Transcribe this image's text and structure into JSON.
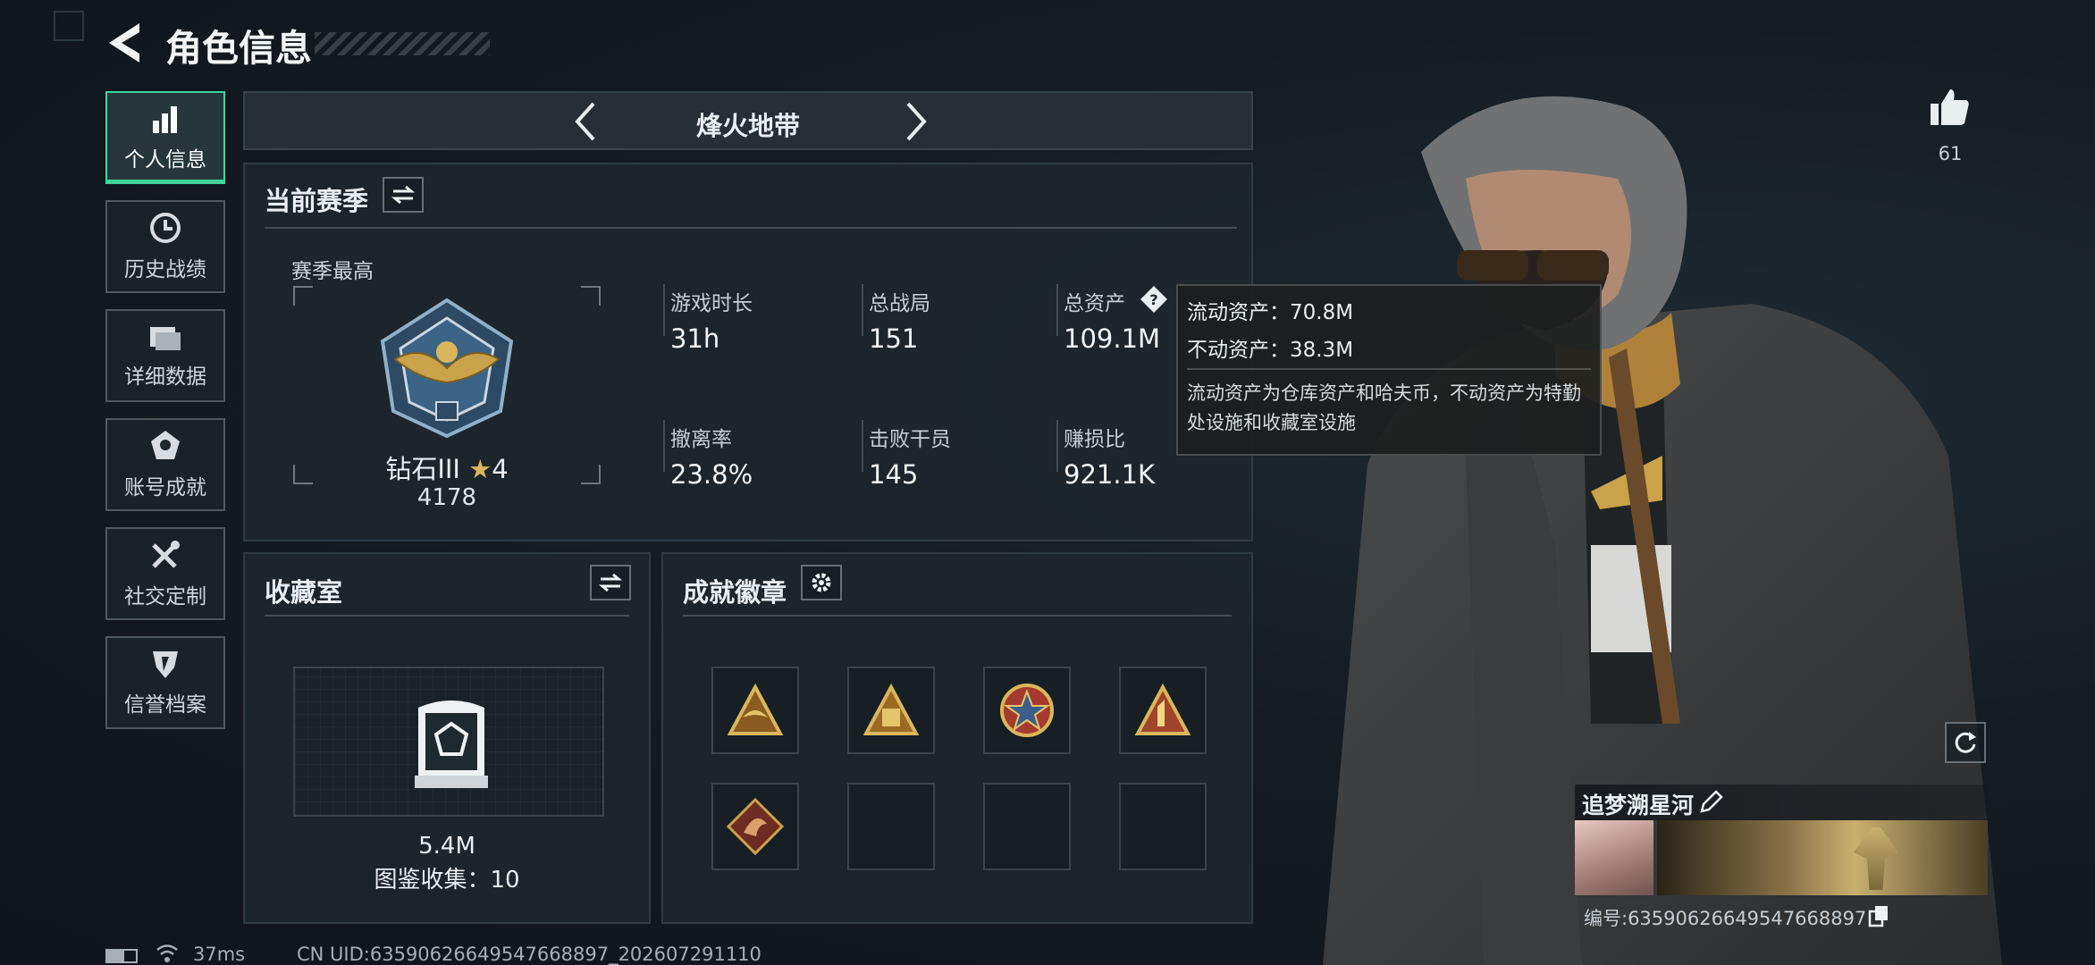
{
  "header": {
    "title": "角色信息"
  },
  "sidebar": {
    "items": [
      {
        "label": "个人信息",
        "icon": "bar-chart-icon",
        "active": true
      },
      {
        "label": "历史战绩",
        "icon": "history-clock-icon"
      },
      {
        "label": "详细数据",
        "icon": "folder-icon"
      },
      {
        "label": "账号成就",
        "icon": "medal-icon"
      },
      {
        "label": "社交定制",
        "icon": "tools-icon"
      },
      {
        "label": "信誉档案",
        "icon": "shield-icon"
      }
    ]
  },
  "mode_selector": {
    "label": "烽火地带"
  },
  "season": {
    "title": "当前赛季",
    "best_label": "赛季最高",
    "rank_name": "钻石III",
    "rank_stars": "4",
    "rank_score": "4178",
    "stats": [
      {
        "label": "游戏时长",
        "value": "31h"
      },
      {
        "label": "总战局",
        "value": "151"
      },
      {
        "label": "总资产",
        "value": "109.1M"
      },
      {
        "label": "撤离率",
        "value": "23.8%"
      },
      {
        "label": "击败干员",
        "value": "145"
      },
      {
        "label": "赚损比",
        "value": "921.1K"
      }
    ]
  },
  "tooltip": {
    "liquid": "流动资产：70.8M",
    "fixed": "不动资产：38.3M",
    "desc": "流动资产为仓库资产和哈夫币，不动资产为特勤处设施和收藏室设施"
  },
  "collection": {
    "title": "收藏室",
    "value": "5.4M",
    "codex": "图鉴收集：10"
  },
  "achievements": {
    "title": "成就徽章",
    "badges": [
      "badge-triangle-bird",
      "badge-triangle-hand",
      "badge-star-round",
      "badge-triangle-horn",
      "badge-dragon-diamond",
      "",
      "",
      ""
    ]
  },
  "likes": {
    "count": "61"
  },
  "player": {
    "name": "追梦溯星河",
    "id": "编号:6359062664954766889​7"
  },
  "status": {
    "ping": "37ms",
    "uid": "CN UID:6359062664954766889​7_202607291110"
  },
  "colors": {
    "accent": "#3fd39a",
    "gold": "#c9a24a"
  }
}
